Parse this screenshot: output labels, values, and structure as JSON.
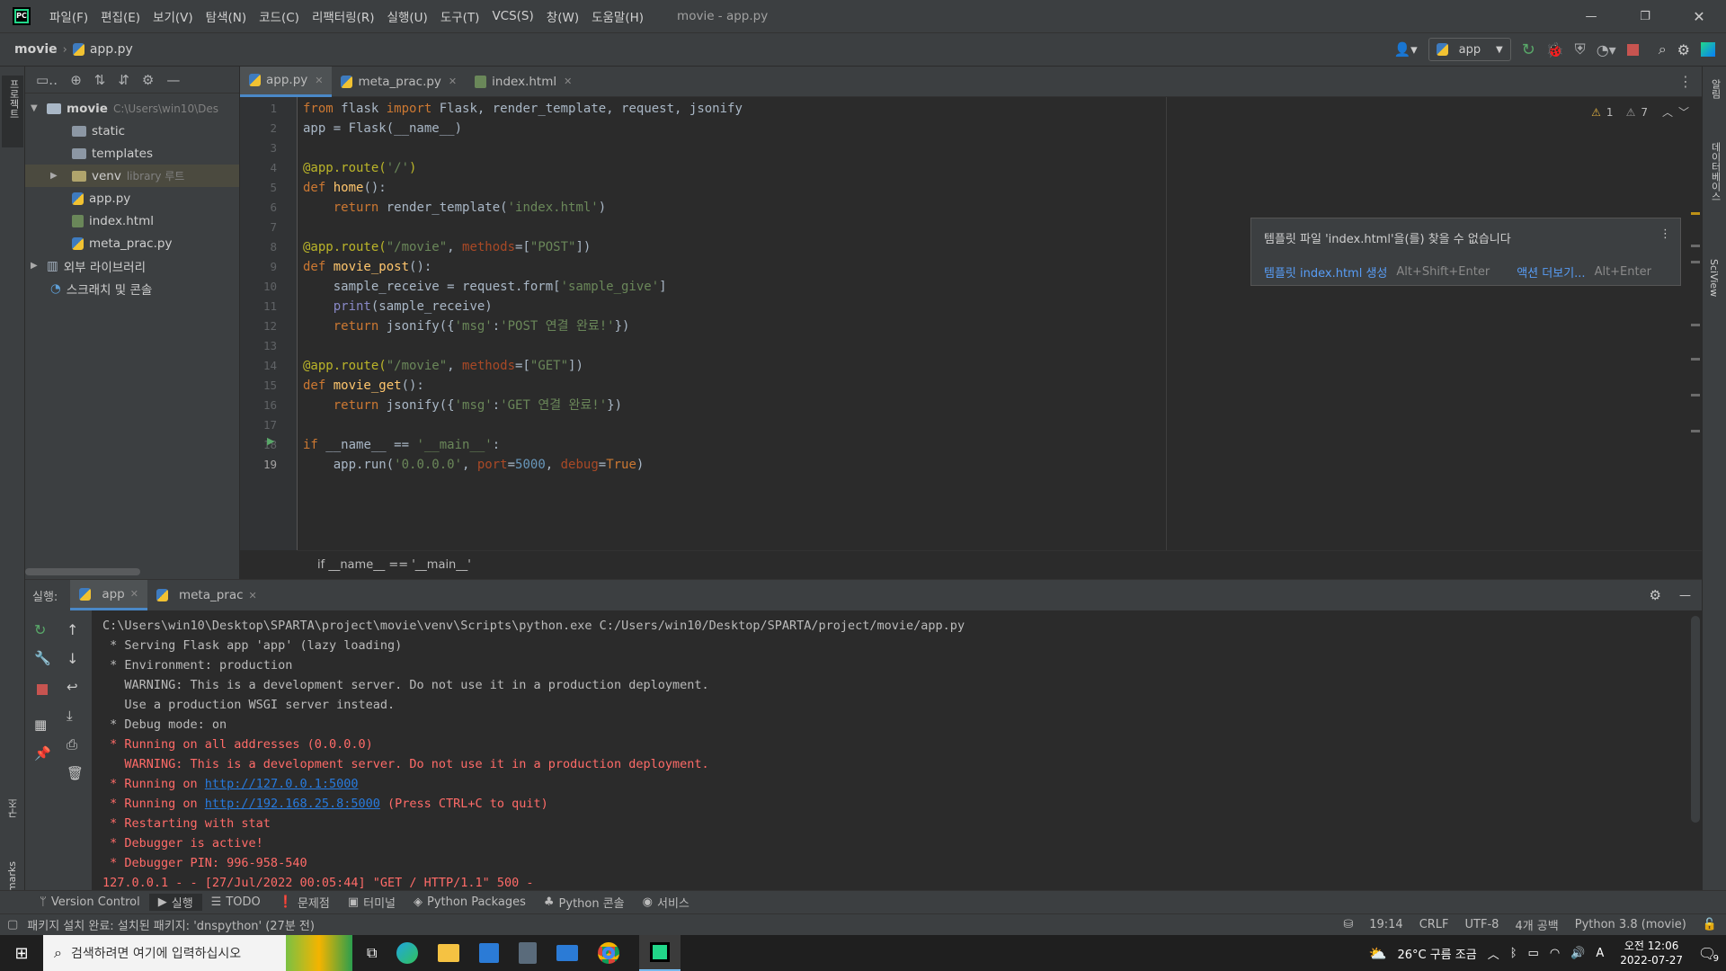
{
  "titlebar": {
    "menus": [
      "파일(F)",
      "편집(E)",
      "보기(V)",
      "탐색(N)",
      "코드(C)",
      "리팩터링(R)",
      "실행(U)",
      "도구(T)",
      "VCS(S)",
      "창(W)",
      "도움말(H)"
    ],
    "title": "movie - app.py"
  },
  "navbar": {
    "project": "movie",
    "file": "app.py",
    "run_config": "app"
  },
  "project_panel": {
    "items": [
      {
        "label": "movie",
        "hint": "C:\\Users\\win10\\Des"
      },
      {
        "label": "static"
      },
      {
        "label": "templates"
      },
      {
        "label": "venv",
        "hint": "library 루트"
      },
      {
        "label": "app.py"
      },
      {
        "label": "index.html"
      },
      {
        "label": "meta_prac.py"
      },
      {
        "label": "외부 라이브러리"
      },
      {
        "label": "스크래치 및 콘솔"
      }
    ]
  },
  "editor": {
    "tabs": [
      "app.py",
      "meta_prac.py",
      "index.html"
    ],
    "warnings": {
      "w1": "1",
      "w2": "7"
    },
    "line_numbers": [
      "1",
      "2",
      "3",
      "4",
      "5",
      "6",
      "7",
      "8",
      "9",
      "10",
      "11",
      "12",
      "13",
      "14",
      "15",
      "16",
      "17",
      "18",
      "19"
    ],
    "breadcrumb": "if __name__ == '__main__'"
  },
  "popup": {
    "message": "템플릿 파일 'index.html'을(를) 찾을 수 없습니다",
    "action1": "템플릿 index.html 생성",
    "shortcut1": "Alt+Shift+Enter",
    "action2": "액션 더보기...",
    "shortcut2": "Alt+Enter"
  },
  "run": {
    "label": "실행:",
    "tabs": [
      "app",
      "meta_prac"
    ],
    "output": [
      "C:\\Users\\win10\\Desktop\\SPARTA\\project\\movie\\venv\\Scripts\\python.exe C:/Users/win10/Desktop/SPARTA/project/movie/app.py",
      " * Serving Flask app 'app' (lazy loading)",
      " * Environment: production",
      "   WARNING: This is a development server. Do not use it in a production deployment.",
      "   Use a production WSGI server instead.",
      " * Debug mode: on"
    ],
    "err_output": [
      " * Running on all addresses (0.0.0.0)",
      "   WARNING: This is a development server. Do not use it in a production deployment."
    ],
    "running1_prefix": " * Running on ",
    "running1_link": "http://127.0.0.1:5000",
    "running2_prefix": " * Running on ",
    "running2_link": "http://192.168.25.8:5000",
    "running2_suffix": " (Press CTRL+C to quit)",
    "err_output2": [
      " * Restarting with stat",
      " * Debugger is active!",
      " * Debugger PIN: 996-958-540",
      "127.0.0.1 - - [27/Jul/2022 00:05:44] \"GET / HTTP/1.1\" 500 -"
    ]
  },
  "bottom_tabs": [
    "Version Control",
    "실행",
    "TODO",
    "문제점",
    "터미널",
    "Python Packages",
    "Python 콘솔",
    "서비스"
  ],
  "statusbar": {
    "message": "패키지 설치 완료: 설치된 패키지: 'dnspython' (27분 전)",
    "position": "19:14",
    "line_sep": "CRLF",
    "encoding": "UTF-8",
    "indent": "4개 공백",
    "interpreter": "Python 3.8 (movie)"
  },
  "taskbar": {
    "search_placeholder": "검색하려면 여기에 입력하십시오",
    "weather": "26°C 구름 조금",
    "time": "오전 12:06",
    "date": "2022-07-27",
    "notif_count": "9"
  },
  "side_labels": {
    "left_top": "프로젝트",
    "left_mid": "구조",
    "left_bottom": "Bookmarks",
    "right1": "알림",
    "right2": "데이터베이스",
    "right3": "SciView"
  }
}
